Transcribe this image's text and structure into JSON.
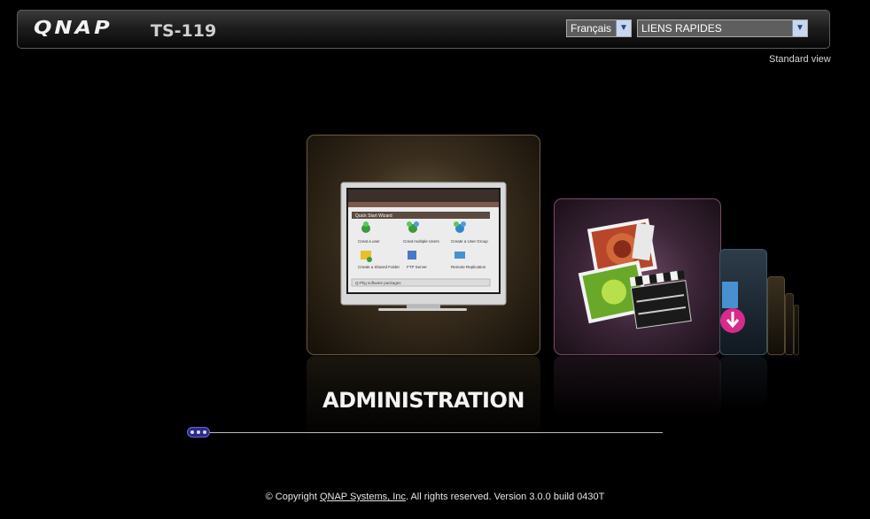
{
  "header": {
    "logo": "QNAP",
    "model": "TS-119",
    "language": {
      "selected": "Français"
    },
    "quick_links": {
      "selected": "LIENS RAPIDES"
    },
    "standard_view": "Standard view"
  },
  "carousel": {
    "active_title": "ADMINISTRATION",
    "admin_screen": {
      "window_title": "Quick Start Wizard",
      "items": [
        "Creat a user",
        "Creat multiple Users",
        "Create a User Group",
        "Create a Shared Folder",
        "FTP Server",
        "Remote Replication"
      ],
      "footer_text": "Q-Pkg software packages"
    }
  },
  "footer": {
    "prefix": "© Copyright ",
    "company": "QNAP Systems, Inc",
    "suffix": ". All rights reserved. Version 3.0.0 build 0430T"
  }
}
